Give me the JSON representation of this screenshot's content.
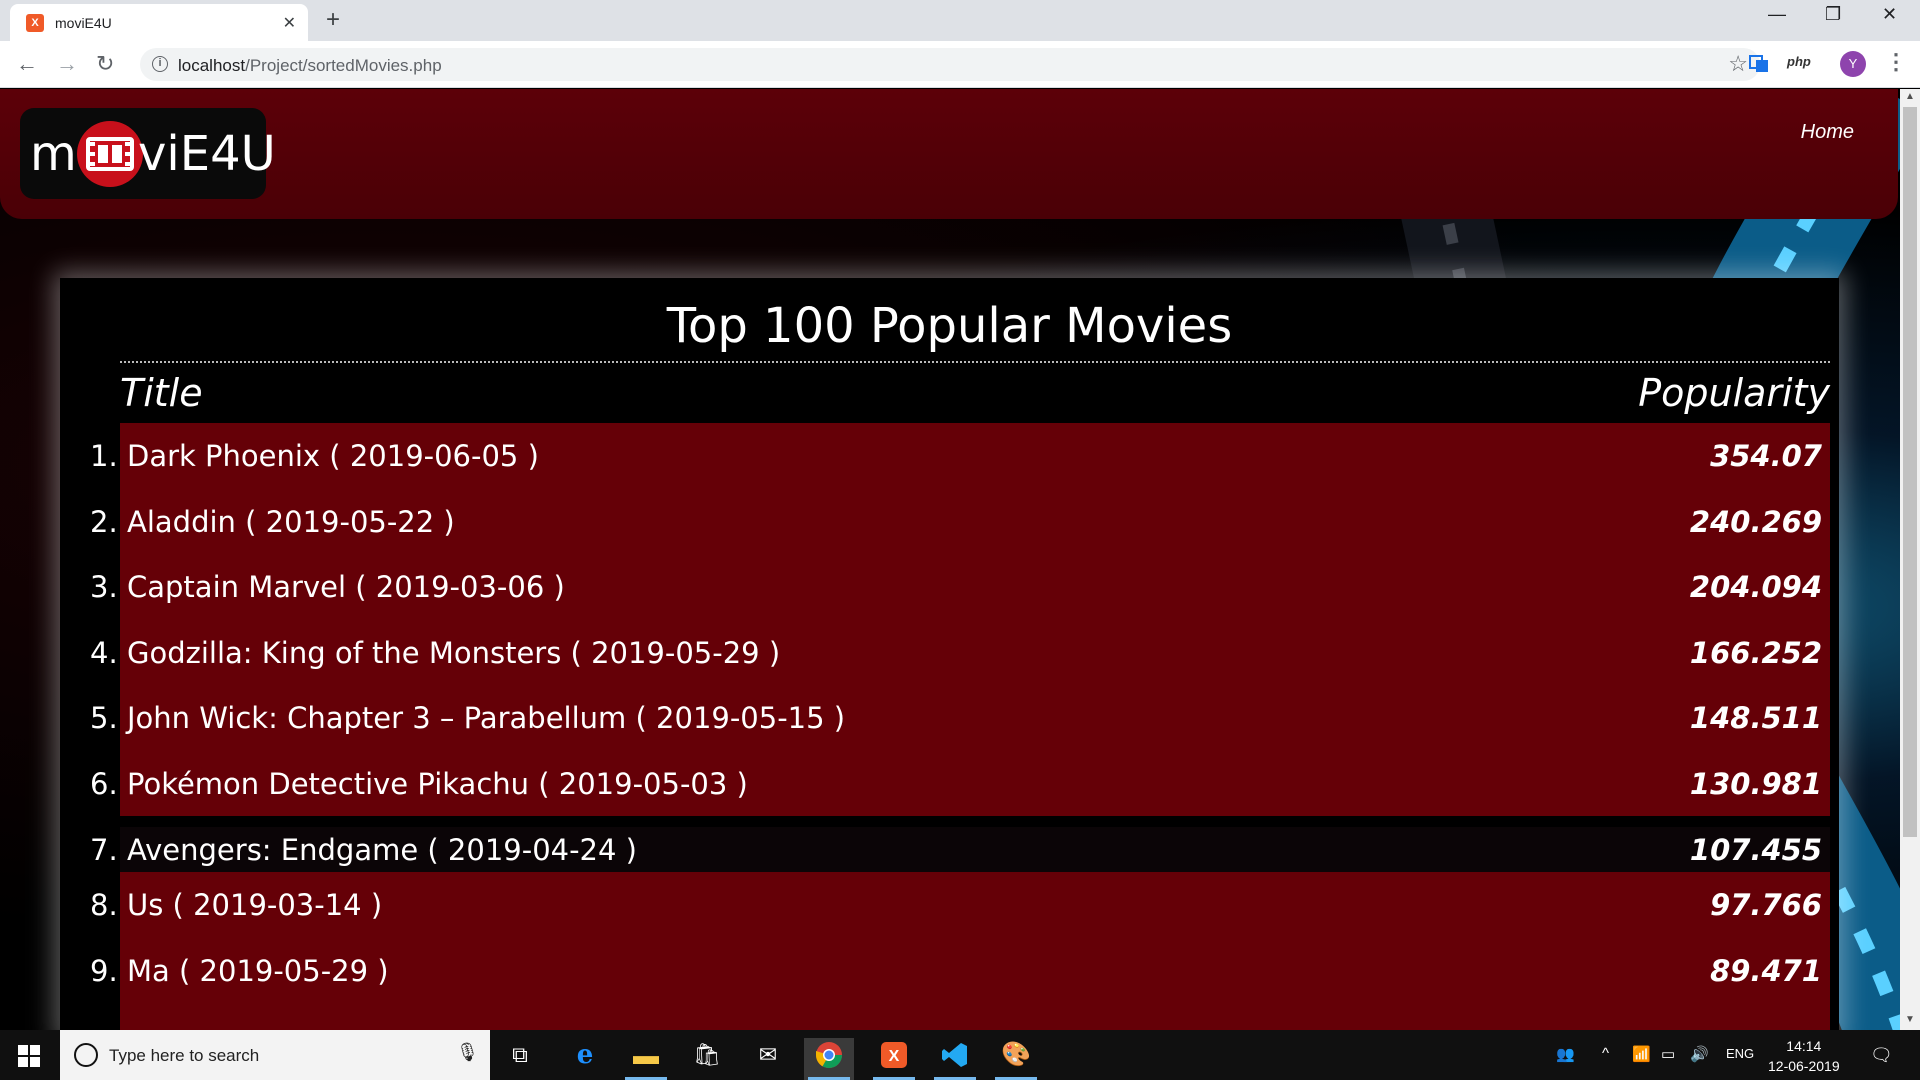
{
  "browser": {
    "tab_title": "moviE4U",
    "tab_favicon": "XAMPP",
    "url_host": "localhost",
    "url_path": "/Project/sortedMovies.php",
    "extension_php": "php",
    "profile_initial": "Y"
  },
  "site": {
    "logo_left": "m",
    "logo_right": "viE4U",
    "nav_home": "Home",
    "page_title": "Top 100 Popular Movies",
    "col_title": "Title",
    "col_popularity": "Popularity"
  },
  "movies": [
    {
      "rank": "1.",
      "title": "Dark Phoenix ( 2019-06-05 )",
      "popularity": "354.07"
    },
    {
      "rank": "2.",
      "title": "Aladdin ( 2019-05-22 )",
      "popularity": "240.269"
    },
    {
      "rank": "3.",
      "title": "Captain Marvel ( 2019-03-06 )",
      "popularity": "204.094"
    },
    {
      "rank": "4.",
      "title": "Godzilla: King of the Monsters ( 2019-05-29 )",
      "popularity": "166.252"
    },
    {
      "rank": "5.",
      "title": "John Wick: Chapter 3 – Parabellum ( 2019-05-15 )",
      "popularity": "148.511"
    },
    {
      "rank": "6.",
      "title": "Pokémon Detective Pikachu ( 2019-05-03 )",
      "popularity": "130.981"
    },
    {
      "rank": "7.",
      "title": "Avengers: Endgame ( 2019-04-24 )",
      "popularity": "107.455"
    },
    {
      "rank": "8.",
      "title": "Us ( 2019-03-14 )",
      "popularity": "97.766"
    },
    {
      "rank": "9.",
      "title": "Ma ( 2019-05-29 )",
      "popularity": "89.471"
    }
  ],
  "taskbar": {
    "search_placeholder": "Type here to search",
    "language": "ENG",
    "time": "14:14",
    "date": "12-06-2019"
  },
  "colors": {
    "header_red": "#5c0008",
    "row_red": "#6e0008",
    "accent_blue": "#1ea0dc"
  }
}
